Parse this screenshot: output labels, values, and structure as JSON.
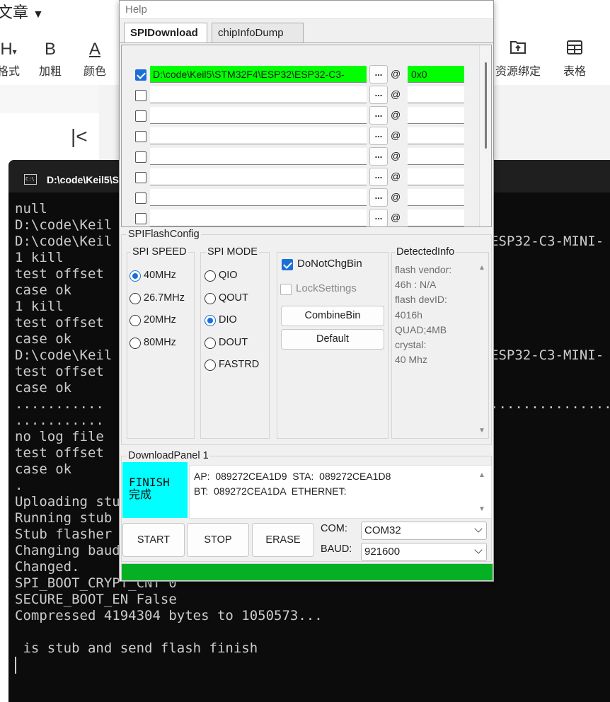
{
  "editor": {
    "title": "文章",
    "toolbar": [
      {
        "icon": "H",
        "label": "格式"
      },
      {
        "icon": "B",
        "label": "加粗"
      },
      {
        "icon": "A",
        "label": "颜色"
      },
      {
        "icon": "upload-folder-icon",
        "label": "资源绑定"
      },
      {
        "icon": "table-icon",
        "label": "表格"
      }
    ],
    "collapse_icon": "|<"
  },
  "terminal": {
    "tab_title": "D:\\code\\Keil5\\S",
    "lines": [
      "null",
      "D:\\code\\Keil",
      "D:\\code\\Keil",
      "1 kill",
      "test offset",
      "case ok",
      "1 kill",
      "test offset",
      "case ok",
      "D:\\code\\Keil",
      "test offset",
      "case ok",
      "...........",
      "...........",
      "no log file",
      "test offset",
      "case ok",
      ".",
      "Uploading stu",
      "Running stub",
      "Stub flasher",
      "Changing baud",
      "Changed.",
      "SPI_BOOT_CRYPT_CNT 0",
      "SECURE_BOOT_EN False",
      "Compressed 4194304 bytes to 1050573...",
      "",
      " is stub and send flash finish"
    ],
    "right_fragments": [
      "ESP32-C3-MINI-",
      "ESP32-C3-MINI-",
      "..............."
    ]
  },
  "tool": {
    "menu": "Help",
    "tabs": [
      "SPIDownload",
      "chipInfoDump"
    ],
    "files": [
      {
        "checked": true,
        "path": "D:\\code\\Keil5\\STM32F4\\ESP32\\ESP32-C3-",
        "browse": "...",
        "at": "@",
        "addr": "0x0"
      },
      {
        "checked": false,
        "path": "",
        "browse": "...",
        "at": "@",
        "addr": ""
      },
      {
        "checked": false,
        "path": "",
        "browse": "...",
        "at": "@",
        "addr": ""
      },
      {
        "checked": false,
        "path": "",
        "browse": "...",
        "at": "@",
        "addr": ""
      },
      {
        "checked": false,
        "path": "",
        "browse": "...",
        "at": "@",
        "addr": ""
      },
      {
        "checked": false,
        "path": "",
        "browse": "...",
        "at": "@",
        "addr": ""
      },
      {
        "checked": false,
        "path": "",
        "browse": "...",
        "at": "@",
        "addr": ""
      },
      {
        "checked": false,
        "path": "",
        "browse": "...",
        "at": "@",
        "addr": ""
      }
    ],
    "flash_config": {
      "title": "SPIFlashConfig",
      "speed_title": "SPI SPEED",
      "speeds": [
        {
          "label": "40MHz",
          "selected": true
        },
        {
          "label": "26.7MHz",
          "selected": false
        },
        {
          "label": "20MHz",
          "selected": false
        },
        {
          "label": "80MHz",
          "selected": false
        }
      ],
      "mode_title": "SPI MODE",
      "modes": [
        {
          "label": "QIO",
          "selected": false
        },
        {
          "label": "QOUT",
          "selected": false
        },
        {
          "label": "DIO",
          "selected": true
        },
        {
          "label": "DOUT",
          "selected": false
        },
        {
          "label": "FASTRD",
          "selected": false
        }
      ],
      "do_not_chg_bin": "DoNotChgBin",
      "lock_settings": "LockSettings",
      "combine_bin": "CombineBin",
      "default": "Default",
      "detected_title": "DetectedInfo",
      "detected_text": "flash vendor:\n46h : N/A\nflash devID:\n4016h\nQUAD;4MB\ncrystal:\n40 Mhz"
    },
    "download_panel": {
      "title": "DownloadPanel 1",
      "status_line1": "FINISH",
      "status_line2": "完成",
      "mac_line1": "AP:  089272CEA1D9  STA:  089272CEA1D8",
      "mac_line2": "BT:  089272CEA1DA  ETHERNET:",
      "start": "START",
      "stop": "STOP",
      "erase": "ERASE",
      "com_label": "COM:",
      "com_value": "COM32",
      "baud_label": "BAUD:",
      "baud_value": "921600",
      "progress": 1.0
    },
    "colors": {
      "finish_bg": "#00ffff",
      "file_highlight": "#00ff00",
      "progress": "#06b025",
      "accent": "#1c6fd8"
    }
  }
}
